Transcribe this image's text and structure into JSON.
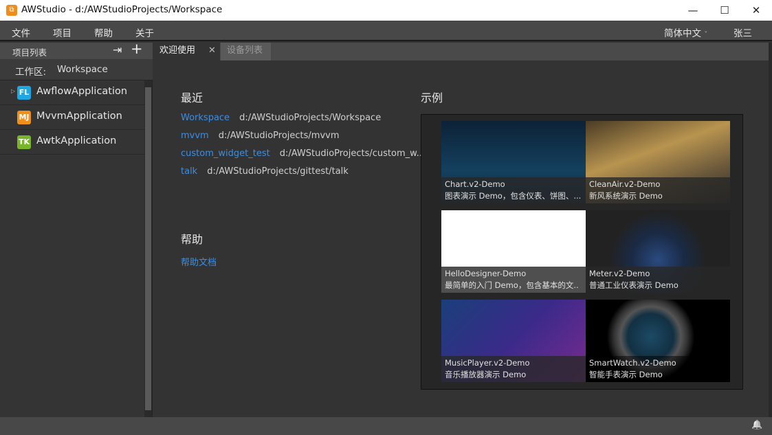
{
  "window": {
    "title": "AWStudio - d:/AWStudioProjects/Workspace",
    "minimize": "—",
    "maximize": "☐",
    "close": "✕"
  },
  "menu": {
    "items": [
      "文件",
      "项目",
      "帮助",
      "关于"
    ],
    "language": "简体中文",
    "language_caret": "˅",
    "user": "张三"
  },
  "sidebar": {
    "title": "项目列表",
    "import_icon": "⇥",
    "add_icon": "+",
    "workspace_label": "工作区:",
    "workspace_name": "Workspace",
    "projects": [
      {
        "badge": "FL",
        "name": "AwflowApplication",
        "color": "#1ea7e1",
        "expandable": true
      },
      {
        "badge": "MJ",
        "name": "MvvmApplication",
        "color": "#f0901c"
      },
      {
        "badge": "TK",
        "name": "AwtkApplication",
        "color": "#78b52a"
      }
    ]
  },
  "tabs": [
    {
      "label": "欢迎使用",
      "active": true,
      "close": "✕"
    },
    {
      "label": "设备列表",
      "active": false
    }
  ],
  "recent": {
    "title": "最近",
    "items": [
      {
        "name": "Workspace",
        "path": "d:/AWStudioProjects/Workspace"
      },
      {
        "name": "mvvm",
        "path": "d:/AWStudioProjects/mvvm"
      },
      {
        "name": "custom_widget_test",
        "path": "d:/AWStudioProjects/custom_w..."
      },
      {
        "name": "talk",
        "path": "d:/AWStudioProjects/gittest/talk"
      }
    ]
  },
  "help": {
    "title": "帮助",
    "link": "帮助文档"
  },
  "examples": {
    "title": "示例",
    "items": [
      {
        "name": "Chart.v2-Demo",
        "desc": "图表演示 Demo，包含仪表、饼图、..."
      },
      {
        "name": "CleanAir.v2-Demo",
        "desc": "新风系统演示 Demo"
      },
      {
        "name": "HelloDesigner-Demo",
        "desc": "最简单的入门 Demo，包含基本的文.."
      },
      {
        "name": "Meter.v2-Demo",
        "desc": "普通工业仪表演示 Demo"
      },
      {
        "name": "MusicPlayer.v2-Demo",
        "desc": "音乐播放器演示 Demo"
      },
      {
        "name": "SmartWatch.v2-Demo",
        "desc": "智能手表演示 Demo"
      }
    ]
  },
  "footer": {
    "bell_icon": "🔔"
  }
}
